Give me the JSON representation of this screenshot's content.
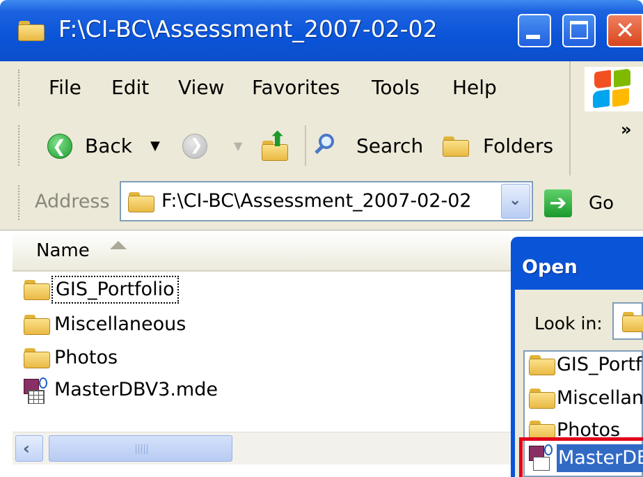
{
  "window": {
    "title": "F:\\CI-BC\\Assessment_2007-02-02",
    "buttons": {
      "minimize": "minimize",
      "maximize": "maximize",
      "close": "close"
    }
  },
  "menu": [
    "File",
    "Edit",
    "View",
    "Favorites",
    "Tools",
    "Help"
  ],
  "toolbar": {
    "back_label": "Back",
    "search_label": "Search",
    "folders_label": "Folders",
    "chevron": "»"
  },
  "address": {
    "label": "Address",
    "value": "F:\\CI-BC\\Assessment_2007-02-02",
    "go_label": "Go"
  },
  "list": {
    "column_name": "Name",
    "items": [
      {
        "name": "GIS_Portfolio",
        "type": "folder",
        "focused": true
      },
      {
        "name": "Miscellaneous",
        "type": "folder"
      },
      {
        "name": "Photos",
        "type": "folder"
      },
      {
        "name": "MasterDBV3.mde",
        "type": "access-db"
      }
    ]
  },
  "dialog": {
    "title": "Open",
    "look_in_label": "Look in:",
    "items": [
      "GIS_Portf",
      "Miscellane",
      "Photos",
      "MasterDB"
    ]
  },
  "colors": {
    "titlebar": "#0a54d8",
    "chrome": "#ece9d8",
    "selection": "#316ac5",
    "highlight_box": "#e0001a"
  }
}
